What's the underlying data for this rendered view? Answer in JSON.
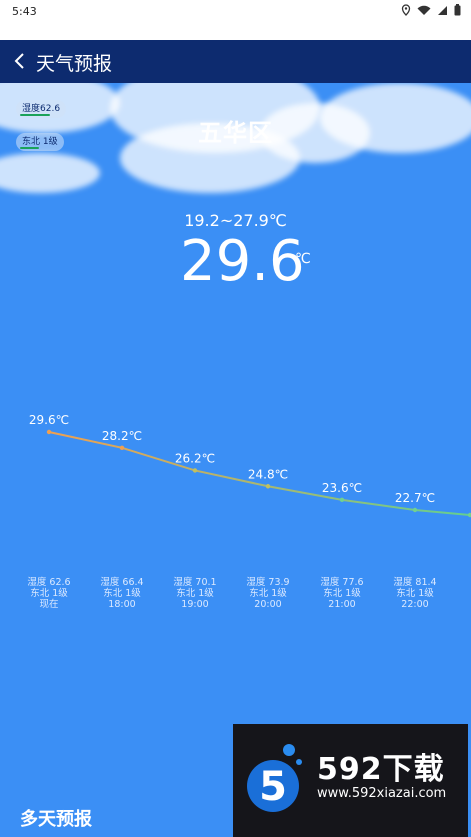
{
  "status_bar": {
    "time": "5:43"
  },
  "app_bar": {
    "title": "天气预报"
  },
  "weather": {
    "humidity_badge": "湿度62.6",
    "wind_badge": "东北 1级",
    "city": "五华区",
    "range": "19.2~27.9℃",
    "current_temp": "29.6",
    "temp_unit": "℃"
  },
  "hourly": [
    {
      "temp": 29.6,
      "label": "29.6℃",
      "humidity": "湿度 62.6",
      "wind": "东北 1级",
      "time": "现在"
    },
    {
      "temp": 28.2,
      "label": "28.2℃",
      "humidity": "湿度 66.4",
      "wind": "东北 1级",
      "time": "18:00"
    },
    {
      "temp": 26.2,
      "label": "26.2℃",
      "humidity": "湿度 70.1",
      "wind": "东北 1级",
      "time": "19:00"
    },
    {
      "temp": 24.8,
      "label": "24.8℃",
      "humidity": "湿度 73.9",
      "wind": "东北 1级",
      "time": "20:00"
    },
    {
      "temp": 23.6,
      "label": "23.6℃",
      "humidity": "湿度 77.6",
      "wind": "东北 1级",
      "time": "21:00"
    },
    {
      "temp": 22.7,
      "label": "22.7℃",
      "humidity": "湿度 81.4",
      "wind": "东北 1级",
      "time": "22:00"
    }
  ],
  "section": {
    "multi_day": "多天预报"
  },
  "watermark": {
    "brand": "592下载",
    "url": "www.592xiazai.com"
  },
  "colors": {
    "app_bar": "#0d2b6f",
    "sky": "#3b8ff5",
    "line_start": "#f0a050",
    "line_end": "#60d090"
  }
}
